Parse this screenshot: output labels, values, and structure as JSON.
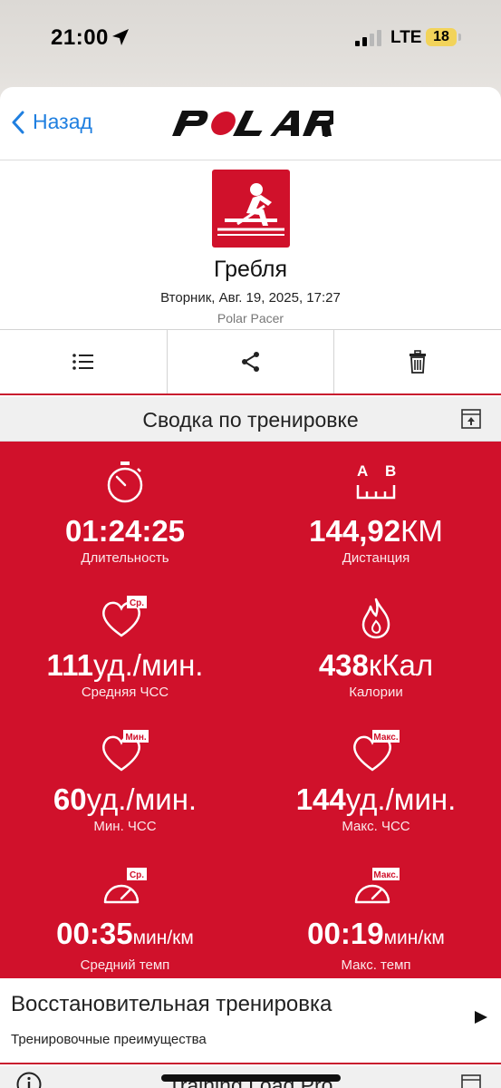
{
  "status_bar": {
    "time": "21:00",
    "network": "LTE",
    "battery": "18"
  },
  "nav": {
    "back_label": "Назад",
    "logo": "POLAR"
  },
  "activity": {
    "sport": "Гребля",
    "datetime": "Вторник, Авг. 19, 2025, 17:27",
    "device": "Polar Pacer"
  },
  "toolbar": {
    "icons": [
      "list-icon",
      "share-icon",
      "trash-icon"
    ]
  },
  "summary": {
    "title": "Сводка по тренировке",
    "stats": [
      {
        "value": "01:24:25",
        "unit": "",
        "label": "Длительность",
        "icon": "stopwatch-icon"
      },
      {
        "value": "144,92",
        "unit": "КМ",
        "label": "Дистанция",
        "icon": "distance-ab-icon",
        "icon_text_a": "A",
        "icon_text_b": "B"
      },
      {
        "value": "111",
        "unit": "уд./мин.",
        "label": "Средняя ЧСС",
        "icon": "heart-avg-icon",
        "badge": "Ср."
      },
      {
        "value": "438",
        "unit": "кКал",
        "label": "Калории",
        "icon": "flame-icon"
      },
      {
        "value": "60",
        "unit": "уд./мин.",
        "label": "Мин. ЧСС",
        "icon": "heart-min-icon",
        "badge": "Мин."
      },
      {
        "value": "144",
        "unit": "уд./мин.",
        "label": "Макс. ЧСС",
        "icon": "heart-max-icon",
        "badge": "Макс."
      },
      {
        "value": "00:35",
        "unit": "мин/км",
        "label": "Средний темп",
        "icon": "pace-avg-icon",
        "badge": "Ср."
      },
      {
        "value": "00:19",
        "unit": "мин/км",
        "label": "Макс. темп",
        "icon": "pace-max-icon",
        "badge": "Макс."
      }
    ]
  },
  "training_benefit": {
    "title": "Восстановительная тренировка",
    "subtitle": "Тренировочные преимущества"
  },
  "next_section": {
    "title": "Training Load Pro"
  },
  "colors": {
    "accent": "#d0112b",
    "link": "#1f7fe0"
  }
}
